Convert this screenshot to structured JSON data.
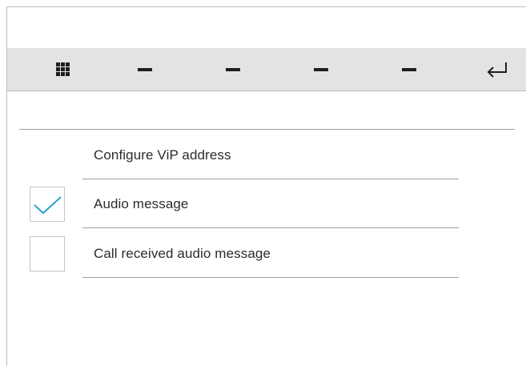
{
  "toolbar": {
    "buttons": [
      {
        "icon": "keypad-icon"
      },
      {
        "icon": "dash-icon"
      },
      {
        "icon": "dash-icon"
      },
      {
        "icon": "dash-icon"
      },
      {
        "icon": "dash-icon"
      },
      {
        "icon": "back-return-icon"
      }
    ]
  },
  "settings": {
    "items": [
      {
        "label": "Configure ViP address",
        "checkbox": null
      },
      {
        "label": "Audio message",
        "checkbox": true
      },
      {
        "label": "Call received audio message",
        "checkbox": false
      }
    ]
  },
  "colors": {
    "accent": "#2a9fd8",
    "toolbar_bg": "#e3e3e3",
    "divider": "#9e9e9e"
  }
}
